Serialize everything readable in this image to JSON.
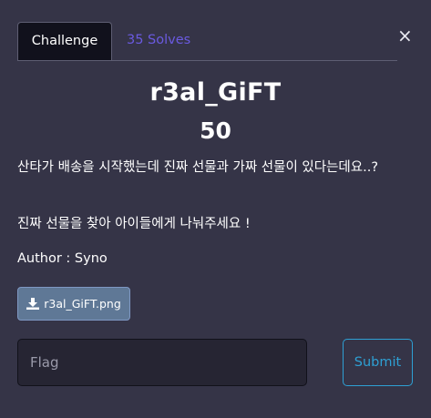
{
  "tabs": {
    "challenge_label": "Challenge",
    "solves_label": "35 Solves"
  },
  "close_symbol": "×",
  "challenge": {
    "name": "r3al_GiFT",
    "points": "50",
    "description_lines": [
      "산타가 배송을 시작했는데 진짜 선물과 가짜 선물이 있다는데요..?",
      "진짜 선물을 찾아 아이들에게 나눠주세요 !"
    ],
    "author": "Author : Syno",
    "file": {
      "label": "r3al_GiFT.png",
      "icon": "download-icon"
    }
  },
  "flag_input": {
    "placeholder": "Flag",
    "value": ""
  },
  "submit_label": "Submit",
  "colors": {
    "background": "#353447",
    "active_tab": "#11111c",
    "solves_link": "#6a5ae0",
    "file_button": "#5f7896",
    "submit_accent": "#2ea0d4",
    "input_background": "#262533"
  }
}
